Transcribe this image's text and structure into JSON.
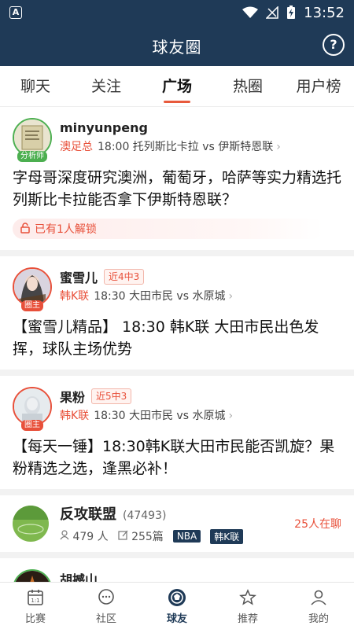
{
  "status_bar": {
    "time": "13:52",
    "app_glyph": "A"
  },
  "header": {
    "title": "球友圈",
    "help_label": "?"
  },
  "tabs": [
    {
      "label": "聊天",
      "active": false
    },
    {
      "label": "关注",
      "active": false
    },
    {
      "label": "广场",
      "active": true
    },
    {
      "label": "热圈",
      "active": false
    },
    {
      "label": "用户榜",
      "active": false
    }
  ],
  "posts": [
    {
      "username": "minyunpeng",
      "badge": "分析师",
      "record": "",
      "league": "澳足总",
      "match": "18:00 托列斯比卡拉 vs 伊斯特恩联",
      "text": "字母哥深度研究澳洲，葡萄牙，哈萨等实力精选托列斯比卡拉能否拿下伊斯特恩联？",
      "lock_text": "已有1人解锁"
    },
    {
      "username": "蜜雪儿",
      "badge": "圈主",
      "record": "近4中3",
      "league": "韩K联",
      "match": "18:30 大田市民 vs 水原城",
      "text": "【蜜雪儿精品】 18:30 韩K联 大田市民出色发挥，球队主场优势"
    },
    {
      "username": "果粉",
      "badge": "圈主",
      "record": "近5中3",
      "league": "韩K联",
      "match": "18:30 大田市民 vs 水原城",
      "text": "【每天一锤】18:30韩K联大田市民能否凯旋？果粉精选之选，逢黑必补！"
    }
  ],
  "circle": {
    "name": "反攻联盟",
    "count": "(47493)",
    "members": "479 人",
    "posts": "255篇",
    "tags": [
      "NBA",
      "韩K联"
    ],
    "online": "25人在聊"
  },
  "next_post": {
    "username": "胡撼山"
  },
  "bottom_nav": [
    {
      "label": "比赛",
      "icon": "calendar-icon",
      "active": false
    },
    {
      "label": "社区",
      "icon": "chat-bubble-icon",
      "active": false
    },
    {
      "label": "球友",
      "icon": "soccer-ball-icon",
      "active": true
    },
    {
      "label": "推荐",
      "icon": "recommend-icon",
      "active": false
    },
    {
      "label": "我的",
      "icon": "profile-icon",
      "active": false
    }
  ],
  "colors": {
    "header_bg": "#1f3a57",
    "accent": "#e8503a",
    "analyst_green": "#4caf50"
  }
}
